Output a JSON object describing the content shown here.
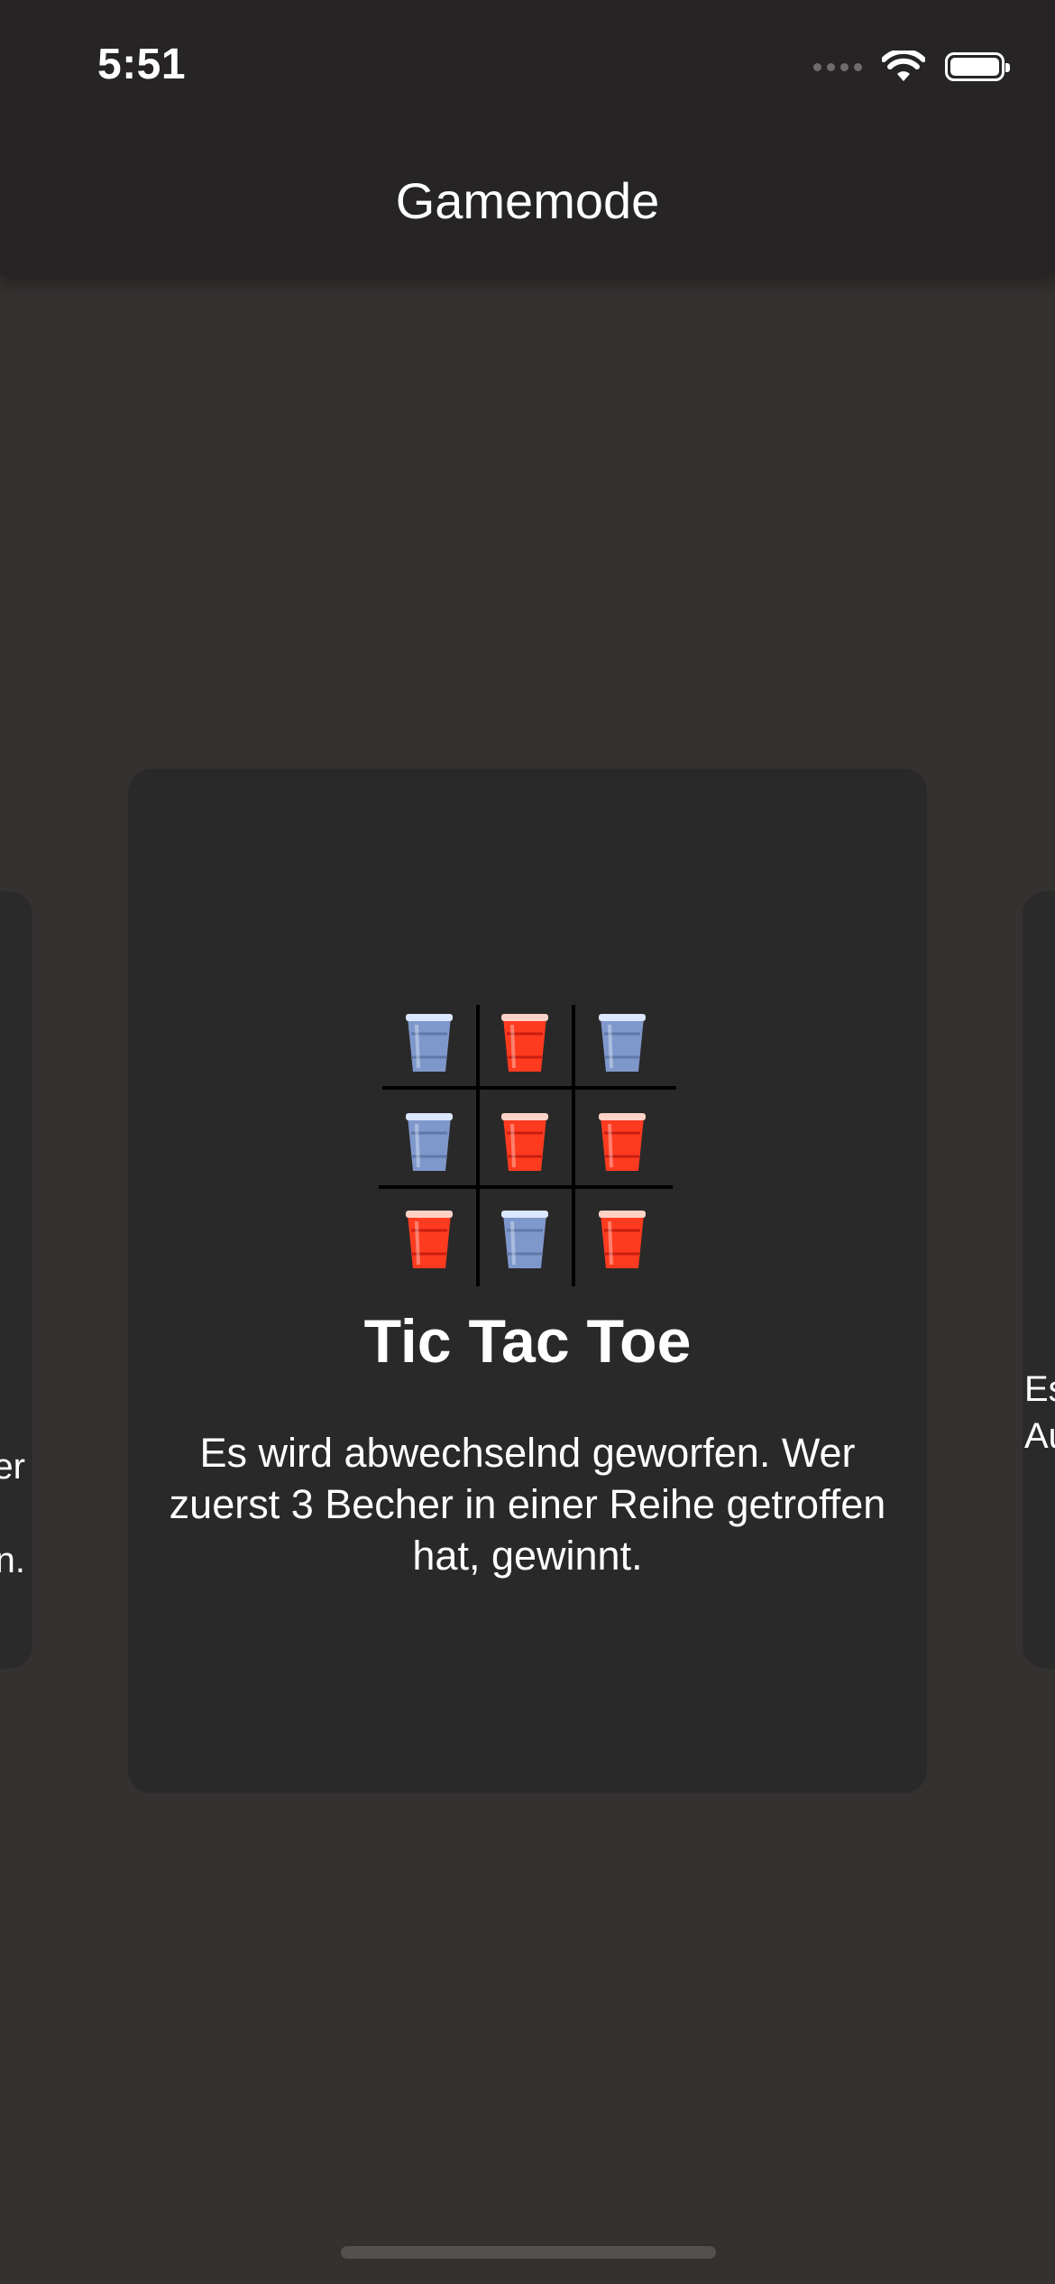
{
  "status_bar": {
    "time": "5:51",
    "icons": [
      "cellular-signal-icon",
      "wifi-icon",
      "battery-icon"
    ]
  },
  "navbar": {
    "title": "Gamemode"
  },
  "carousel": {
    "current": {
      "title": "Tic Tac Toe",
      "description": "Es wird abwechselnd geworfen. Wer zuerst 3 Becher in einer Reihe getroffen hat, gewinnt.",
      "board": [
        [
          "blue",
          "red",
          "blue"
        ],
        [
          "blue",
          "red",
          "red"
        ],
        [
          "red",
          "blue",
          "red"
        ]
      ]
    },
    "previous": {
      "visible_text": "er\n\nn."
    },
    "next": {
      "visible_text": "Es\nAu"
    }
  },
  "colors": {
    "background": "#353131",
    "navbar": "#262424",
    "card": "#2a2929",
    "cup_red": "#ff3b1f",
    "cup_blue": "#7f98cc"
  }
}
